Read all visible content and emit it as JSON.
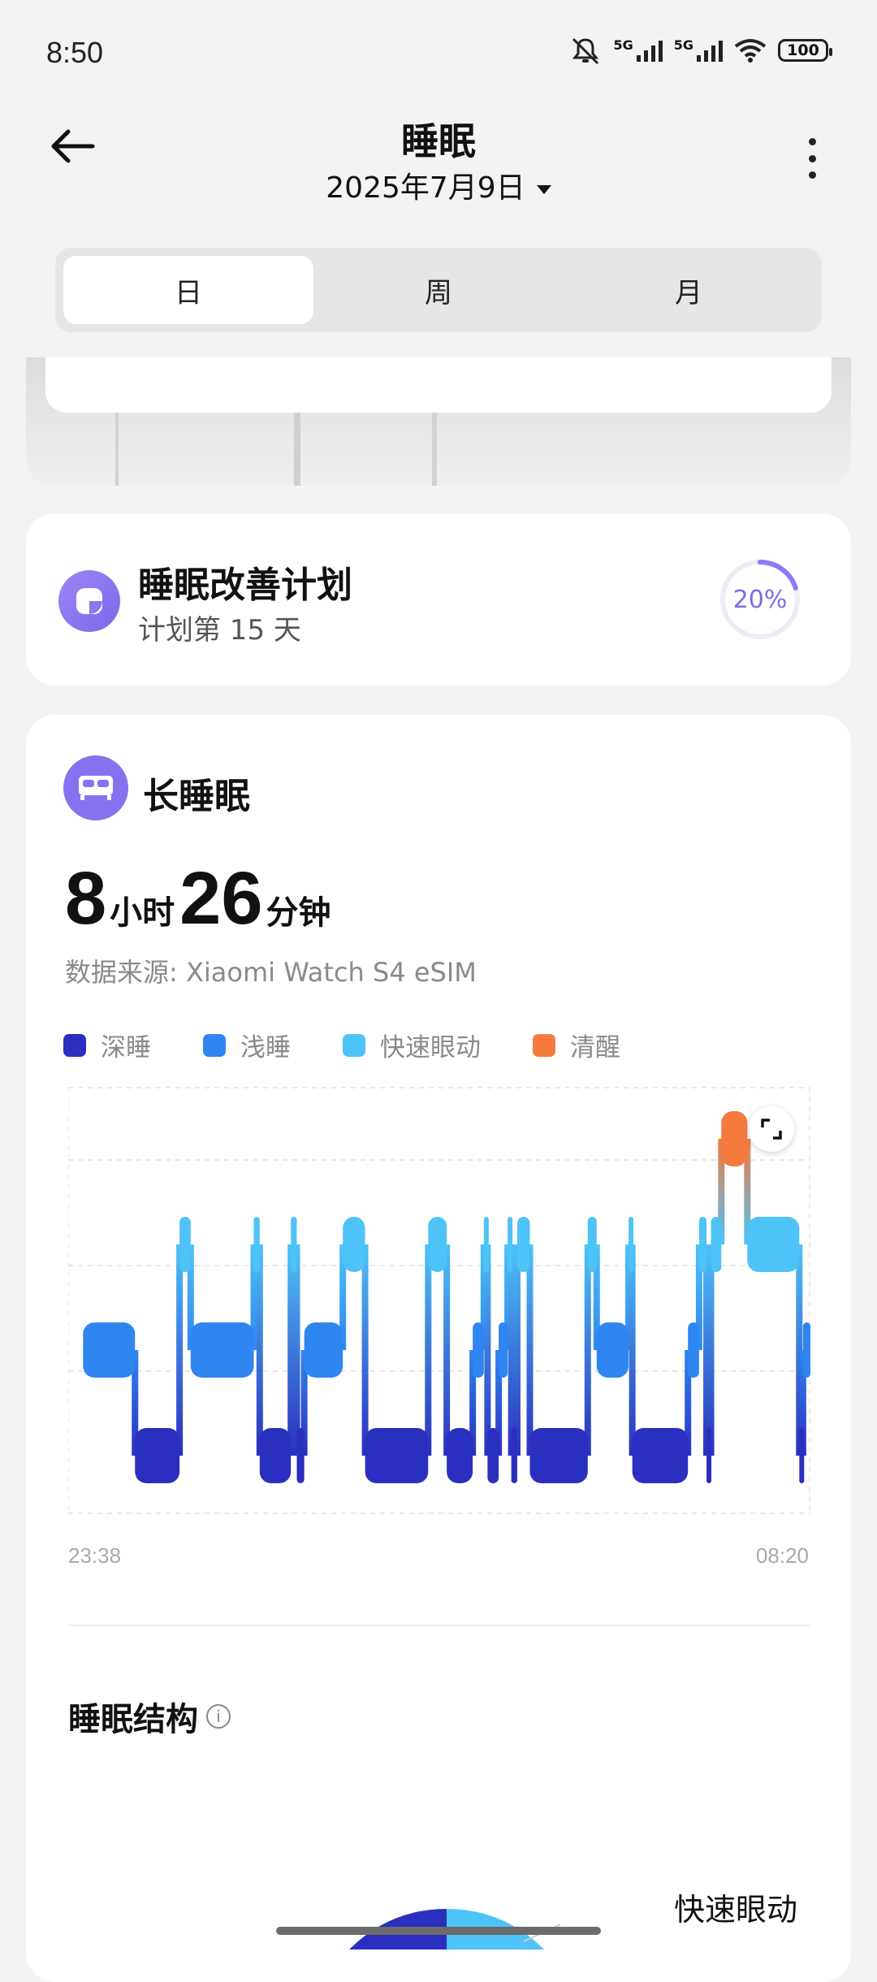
{
  "status_bar": {
    "time": "8:50",
    "battery": "100",
    "network_1": "5G",
    "network_2": "5G"
  },
  "header": {
    "title": "睡眠",
    "date": "2025年7月9日"
  },
  "tabs": [
    {
      "label": "日",
      "active": true
    },
    {
      "label": "周",
      "active": false
    },
    {
      "label": "月",
      "active": false
    }
  ],
  "plan": {
    "title": "睡眠改善计划",
    "subtitle": "计划第 15 天",
    "progress_text": "20%",
    "progress": 0.2
  },
  "sleep": {
    "title": "长睡眠",
    "hours": "8",
    "hours_unit": "小时",
    "minutes": "26",
    "minutes_unit": "分钟",
    "source": "数据来源: Xiaomi Watch S4 eSIM",
    "legend": [
      {
        "label": "深睡",
        "color": "#2a2fbf"
      },
      {
        "label": "浅睡",
        "color": "#2f86f0"
      },
      {
        "label": "快速眼动",
        "color": "#4ec3f7"
      },
      {
        "label": "清醒",
        "color": "#f47a3d"
      }
    ],
    "start_time": "23:38",
    "end_time": "08:20"
  },
  "structure": {
    "title": "睡眠结构",
    "info_icon": "i",
    "rem_label": "快速眼动"
  },
  "chart_data": {
    "type": "hypnogram",
    "x_start": "23:38",
    "x_end": "08:20",
    "stages": [
      "清醒",
      "快速眼动",
      "浅睡",
      "深睡"
    ],
    "segments": [
      {
        "stage": "浅睡",
        "start": 0.02,
        "end": 0.09
      },
      {
        "stage": "深睡",
        "start": 0.09,
        "end": 0.15
      },
      {
        "stage": "快速眼动",
        "start": 0.15,
        "end": 0.165
      },
      {
        "stage": "浅睡",
        "start": 0.165,
        "end": 0.25
      },
      {
        "stage": "快速眼动",
        "start": 0.25,
        "end": 0.258
      },
      {
        "stage": "深睡",
        "start": 0.258,
        "end": 0.3
      },
      {
        "stage": "快速眼动",
        "start": 0.3,
        "end": 0.308
      },
      {
        "stage": "深睡",
        "start": 0.308,
        "end": 0.318
      },
      {
        "stage": "浅睡",
        "start": 0.318,
        "end": 0.37
      },
      {
        "stage": "快速眼动",
        "start": 0.37,
        "end": 0.4
      },
      {
        "stage": "深睡",
        "start": 0.4,
        "end": 0.485
      },
      {
        "stage": "快速眼动",
        "start": 0.485,
        "end": 0.51
      },
      {
        "stage": "深睡",
        "start": 0.51,
        "end": 0.545
      },
      {
        "stage": "浅睡",
        "start": 0.545,
        "end": 0.56
      },
      {
        "stage": "快速眼动",
        "start": 0.56,
        "end": 0.565
      },
      {
        "stage": "深睡",
        "start": 0.565,
        "end": 0.58
      },
      {
        "stage": "浅睡",
        "start": 0.58,
        "end": 0.592
      },
      {
        "stage": "快速眼动",
        "start": 0.592,
        "end": 0.597
      },
      {
        "stage": "深睡",
        "start": 0.597,
        "end": 0.605
      },
      {
        "stage": "快速眼动",
        "start": 0.605,
        "end": 0.622
      },
      {
        "stage": "深睡",
        "start": 0.622,
        "end": 0.7
      },
      {
        "stage": "快速眼动",
        "start": 0.7,
        "end": 0.712
      },
      {
        "stage": "浅睡",
        "start": 0.712,
        "end": 0.755
      },
      {
        "stage": "快速眼动",
        "start": 0.755,
        "end": 0.76
      },
      {
        "stage": "深睡",
        "start": 0.76,
        "end": 0.835
      },
      {
        "stage": "浅睡",
        "start": 0.835,
        "end": 0.85
      },
      {
        "stage": "快速眼动",
        "start": 0.85,
        "end": 0.86
      },
      {
        "stage": "深睡",
        "start": 0.86,
        "end": 0.866
      },
      {
        "stage": "快速眼动",
        "start": 0.866,
        "end": 0.88
      },
      {
        "stage": "清醒",
        "start": 0.88,
        "end": 0.915
      },
      {
        "stage": "快速眼动",
        "start": 0.915,
        "end": 0.985
      },
      {
        "stage": "深睡",
        "start": 0.985,
        "end": 0.99
      },
      {
        "stage": "浅睡",
        "start": 0.99,
        "end": 1.0
      }
    ]
  }
}
